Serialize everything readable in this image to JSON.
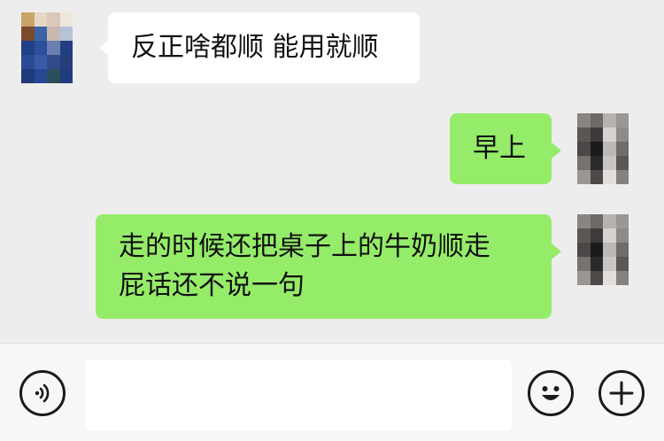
{
  "messages": [
    {
      "side": "incoming",
      "text": "反正啥都顺 能用就顺"
    },
    {
      "side": "outgoing",
      "text": "早上"
    },
    {
      "side": "outgoing",
      "lines": [
        "走的时候还把桌子上的牛奶顺走",
        "屁话还不说一句"
      ]
    }
  ],
  "input_bar": {
    "voice_icon": "voice-icon",
    "emoji_icon": "emoji-icon",
    "plus_icon": "plus-icon",
    "message_value": ""
  },
  "colors": {
    "background": "#ededed",
    "incoming_bubble": "#ffffff",
    "outgoing_bubble": "#95ec69",
    "input_bar": "#f7f7f7"
  }
}
